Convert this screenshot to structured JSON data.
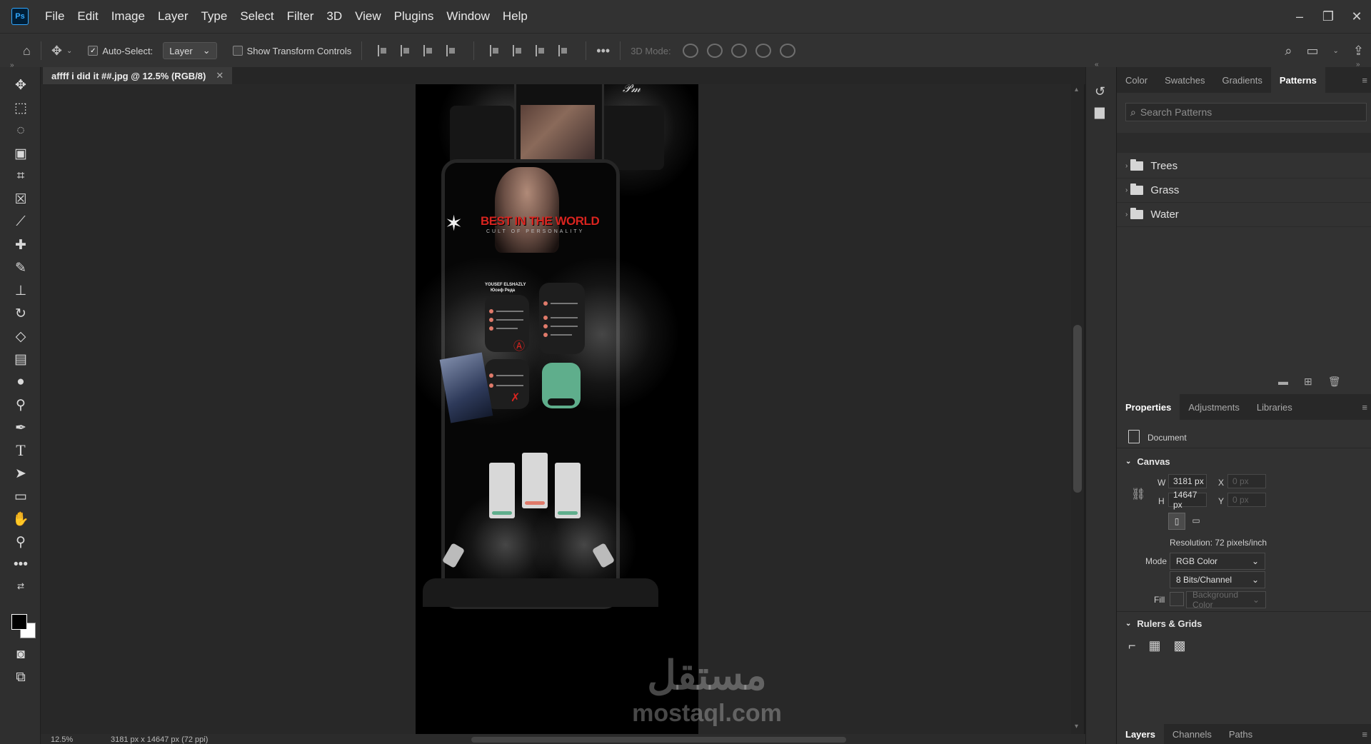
{
  "app": {
    "logo": "Ps",
    "menu": [
      "File",
      "Edit",
      "Image",
      "Layer",
      "Type",
      "Select",
      "Filter",
      "3D",
      "View",
      "Plugins",
      "Window",
      "Help"
    ]
  },
  "options_bar": {
    "auto_select_label": "Auto-Select:",
    "auto_select_checked": true,
    "auto_select_target": "Layer",
    "show_transform_label": "Show Transform Controls",
    "mode_3d_label": "3D Mode:"
  },
  "document": {
    "tab_title": "affff i did it ##.jpg @ 12.5% (RGB/8)",
    "zoom": "12.5%",
    "info": "3181 px x 14647 px (72 ppi)"
  },
  "artwork": {
    "hero_title": "BEST IN THE WORLD",
    "hero_sub": "CULT OF PERSONALITY",
    "profile_name": "YOUSEF ELSHAZLY",
    "profile_sub": "Юсеф Реда"
  },
  "patterns_panel": {
    "tabs": [
      "Color",
      "Swatches",
      "Gradients",
      "Patterns"
    ],
    "active_tab": "Patterns",
    "search_placeholder": "Search Patterns",
    "folders": [
      "Trees",
      "Grass",
      "Water"
    ]
  },
  "properties_panel": {
    "tabs": [
      "Properties",
      "Adjustments",
      "Libraries"
    ],
    "active_tab": "Properties",
    "document_label": "Document",
    "canvas_section": "Canvas",
    "width_label": "W",
    "width_value": "3181 px",
    "height_label": "H",
    "height_value": "14647 px",
    "x_label": "X",
    "x_placeholder": "0 px",
    "y_label": "Y",
    "y_placeholder": "0 px",
    "resolution": "Resolution: 72 pixels/inch",
    "mode_label": "Mode",
    "mode_value": "RGB Color",
    "depth_value": "8 Bits/Channel",
    "fill_label": "Fill",
    "fill_value": "Background Color",
    "rulers_section": "Rulers & Grids"
  },
  "layers_panel": {
    "tabs": [
      "Layers",
      "Channels",
      "Paths"
    ],
    "active_tab": "Layers"
  },
  "watermark": {
    "arabic": "مستقل",
    "latin": "mostaql.com"
  }
}
